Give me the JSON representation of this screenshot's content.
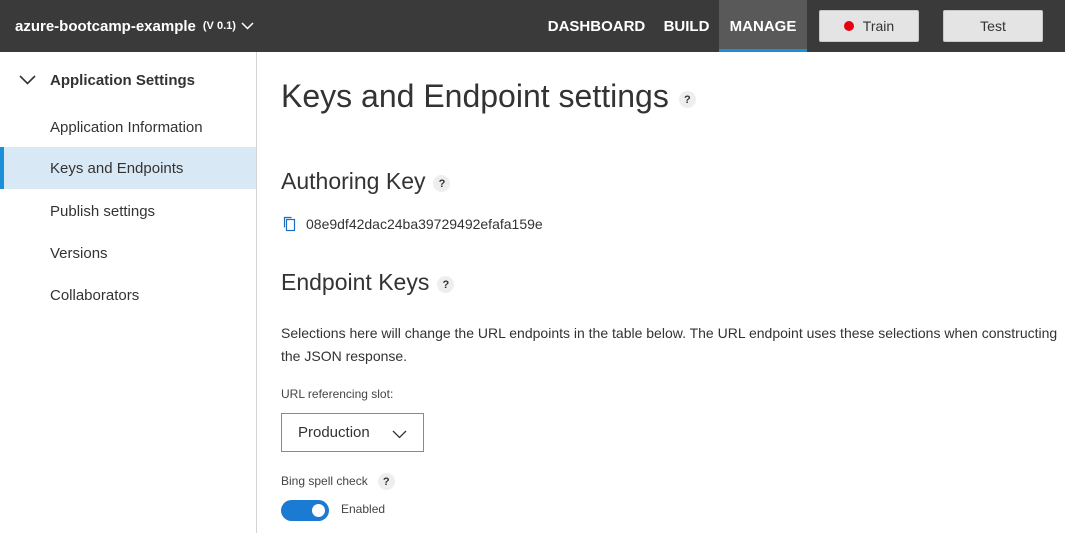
{
  "header": {
    "app_name": "azure-bootcamp-example",
    "version": "(V 0.1)",
    "nav": {
      "dashboard": "DASHBOARD",
      "build": "BUILD",
      "manage": "MANAGE"
    },
    "train_label": "Train",
    "test_label": "Test",
    "colors": {
      "background": "#3a3a3a",
      "active_tab": "#595959",
      "accent": "#1b8fd8",
      "train_dot": "#e60012"
    }
  },
  "sidebar": {
    "section_label": "Application Settings",
    "items": [
      {
        "label": "Application Information",
        "active": false
      },
      {
        "label": "Keys and Endpoints",
        "active": true
      },
      {
        "label": "Publish settings",
        "active": false
      },
      {
        "label": "Versions",
        "active": false
      },
      {
        "label": "Collaborators",
        "active": false
      }
    ]
  },
  "main": {
    "title": "Keys and Endpoint settings",
    "help_glyph": "?",
    "authoring": {
      "heading": "Authoring Key",
      "key": "08e9df42dac24ba39729492efafa159e"
    },
    "endpoint": {
      "heading": "Endpoint Keys",
      "description": "Selections here will change the URL endpoints in the table below. The URL endpoint uses these selections when constructing the JSON response.",
      "slot_label": "URL referencing slot:",
      "slot_value": "Production",
      "bing_label": "Bing spell check",
      "bing_state": "Enabled"
    }
  },
  "icons": [
    "chevron-down-icon",
    "copy-icon",
    "help-icon",
    "record-dot-icon"
  ]
}
